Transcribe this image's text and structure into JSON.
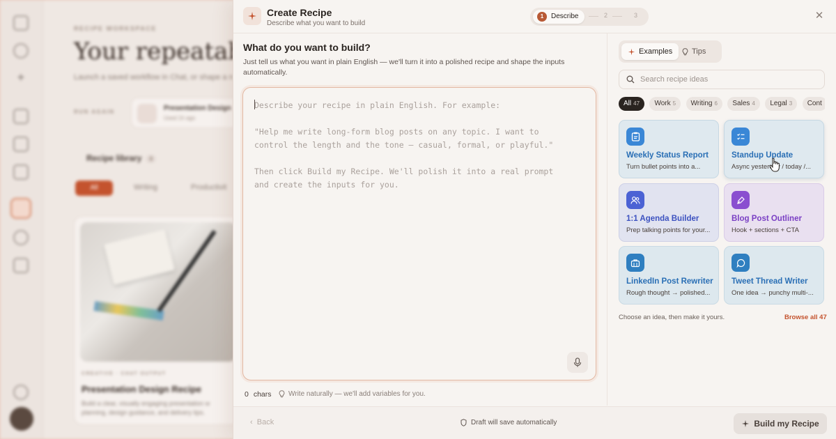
{
  "background": {
    "eyebrow": "RECIPE WORKSPACE",
    "title": "Your repeatable w",
    "subtitle": "Launch a saved workflow in Chat, or shape a n",
    "run_again_label": "RUN AGAIN",
    "recent_card": {
      "title": "Presentation Design",
      "meta": "Used 1h ago"
    },
    "library_label": "Recipe library",
    "library_count": "8",
    "filters": [
      "All",
      "Writing",
      "Productivit"
    ],
    "recipe_card": {
      "meta": "CREATIVE · CHAT OUTPUT",
      "name": "Presentation Design Recipe",
      "desc": "Build a clear, visually engaging presentation w planning, design guidance, and delivery tips."
    }
  },
  "modal": {
    "title": "Create Recipe",
    "subtitle": "Describe what you want to build",
    "steps": [
      {
        "num": "1",
        "label": "Describe"
      },
      {
        "num": "2"
      },
      {
        "num": "3"
      }
    ],
    "question": "What do you want to build?",
    "description": "Just tell us what you want in plain English — we'll turn it into a polished recipe and shape the inputs automatically.",
    "textarea_placeholder": "Describe your recipe in plain English. For example:\n\n\"Help me write long-form blog posts on any topic. I want to\ncontrol the length and the tone — casual, formal, or playful.\"\n\nThen click Build my Recipe. We'll polish it into a real prompt\nand create the inputs for you.",
    "char_count": "0",
    "char_label": "chars",
    "hint": "Write naturally — we'll add variables for you.",
    "tabs": {
      "examples": "Examples",
      "tips": "Tips"
    },
    "search_placeholder": "Search recipe ideas",
    "chips": [
      {
        "label": "All",
        "count": "47",
        "active": true
      },
      {
        "label": "Work",
        "count": "5"
      },
      {
        "label": "Writing",
        "count": "6"
      },
      {
        "label": "Sales",
        "count": "4"
      },
      {
        "label": "Legal",
        "count": "3"
      },
      {
        "label": "Cont",
        "count": ""
      }
    ],
    "cards": [
      {
        "name": "Weekly Status Report",
        "desc": "Turn bullet points into a...",
        "icon": "clipboard-icon"
      },
      {
        "name": "Standup Update",
        "desc": "Async yesterday / today /...",
        "icon": "checklist-icon"
      },
      {
        "name": "1:1 Agenda Builder",
        "desc": "Prep talking points for your...",
        "icon": "users-icon"
      },
      {
        "name": "Blog Post Outliner",
        "desc": "Hook + sections + CTA",
        "icon": "pen-nib-icon"
      },
      {
        "name": "LinkedIn Post Rewriter",
        "desc": "Rough thought → polished...",
        "icon": "briefcase-icon"
      },
      {
        "name": "Tweet Thread Writer",
        "desc": "One idea → punchy multi-...",
        "icon": "chat-bubble-icon"
      }
    ],
    "choose_text": "Choose an idea, then make it yours.",
    "browse_label": "Browse all 47",
    "footer": {
      "back": "Back",
      "draft": "Draft will save automatically",
      "build": "Build my Recipe"
    }
  },
  "colors": {
    "accent": "#c4532e",
    "step_active": "#b85a36",
    "card_blue": "#3a87d6",
    "card_indigo": "#4b62d4",
    "card_purple": "#8a4fd0"
  }
}
